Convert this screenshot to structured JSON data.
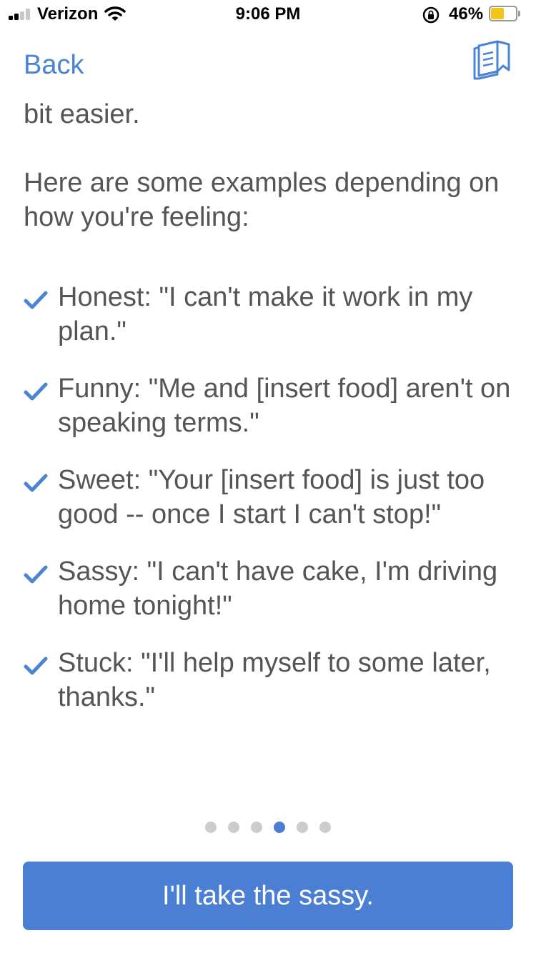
{
  "status_bar": {
    "carrier": "Verizon",
    "time": "9:06 PM",
    "battery_percent": "46%",
    "signal_bars_filled": 2,
    "signal_bars_total": 4,
    "battery_color": "#f5c518"
  },
  "nav": {
    "back_label": "Back",
    "right_icon": "book-icon"
  },
  "content": {
    "para1": "bit easier.",
    "para2": "Here are some examples depending on how you're feeling:",
    "examples": [
      {
        "text": "Honest: \"I can't make it work in my plan.\""
      },
      {
        "text": "Funny: \"Me and [insert food] aren't on speaking terms.\""
      },
      {
        "text": "Sweet: \"Your [insert food] is just too good -- once I start I can't stop!\""
      },
      {
        "text": "Sassy: \"I can't have cake, I'm driving home tonight!\""
      },
      {
        "text": "Stuck: \"I'll help myself to some later, thanks.\""
      }
    ]
  },
  "pager": {
    "total": 6,
    "active_index": 3
  },
  "cta": {
    "label": "I'll take the sassy."
  },
  "colors": {
    "accent": "#4a7fd4",
    "text": "#555555",
    "dot_inactive": "#cccccc"
  }
}
